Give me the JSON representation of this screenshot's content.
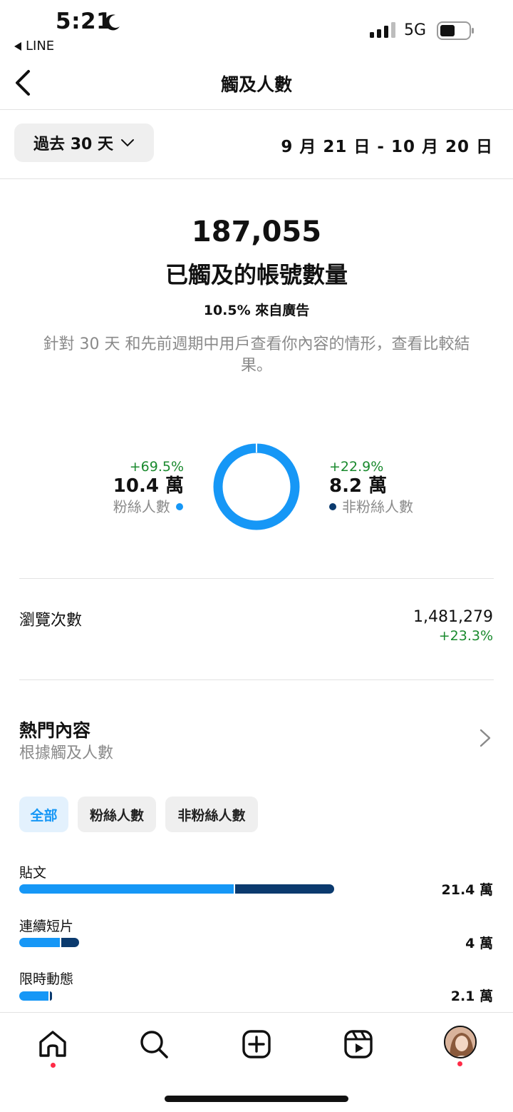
{
  "status_bar": {
    "time": "5:21",
    "back_app": "LINE",
    "network": "5G"
  },
  "nav": {
    "title": "觸及人數"
  },
  "filter": {
    "range_label": "過去 30 天",
    "date_range": "9 月 21 日 - 10 月 20 日"
  },
  "summary": {
    "total": "187,055",
    "label": "已觸及的帳號數量",
    "ad_share": "10.5% 來自廣告",
    "note": "針對 30 天 和先前週期中用戶查看你內容的情形，查看比較結果。"
  },
  "breakdown": {
    "followers": {
      "change": "+69.5%",
      "value": "10.4 萬",
      "label": "粉絲人數",
      "color": "#1697f6"
    },
    "non_followers": {
      "change": "+22.9%",
      "value": "8.2 萬",
      "label": "非粉絲人數",
      "color": "#0b3a6e"
    }
  },
  "views": {
    "label": "瀏覽次數",
    "value": "1,481,279",
    "change": "+23.3%"
  },
  "top_content": {
    "title": "熱門內容",
    "subtitle": "根據觸及人數",
    "chips": [
      {
        "label": "全部",
        "active": true
      },
      {
        "label": "粉絲人數",
        "active": false
      },
      {
        "label": "非粉絲人數",
        "active": false
      }
    ],
    "items": [
      {
        "label": "貼文",
        "value": "21.4 萬",
        "follower_share": 0.68,
        "total_ratio": 1.0
      },
      {
        "label": "連續短片",
        "value": "4 萬",
        "follower_share": 0.68,
        "total_ratio": 0.19
      },
      {
        "label": "限時動態",
        "value": "2.1 萬",
        "follower_share": 0.93,
        "total_ratio": 0.1
      }
    ]
  },
  "tabbar": {
    "icons": [
      "home-icon",
      "search-icon",
      "create-icon",
      "reels-icon",
      "profile-avatar"
    ]
  }
}
